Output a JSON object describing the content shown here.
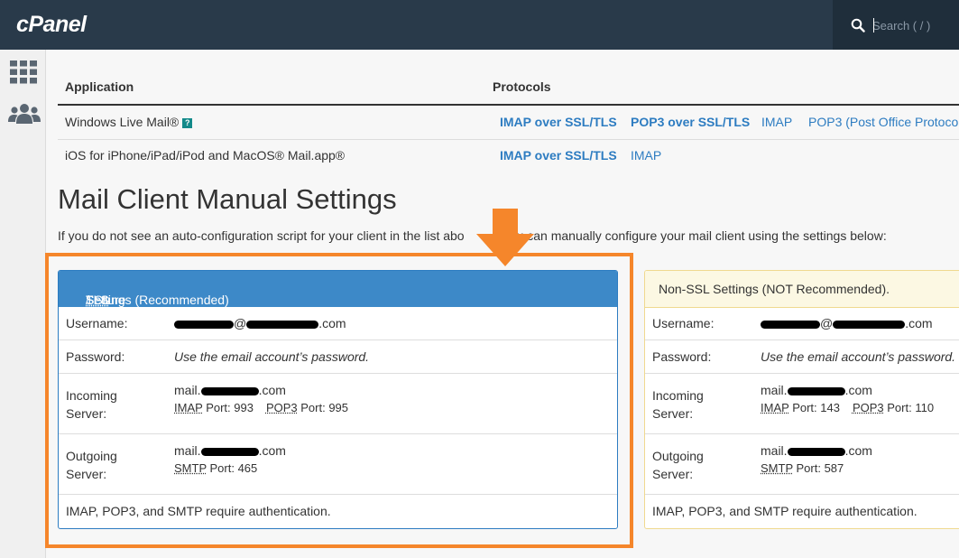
{
  "header": {
    "logo": "cPanel",
    "search_placeholder": "Search ( / )"
  },
  "table": {
    "col_application": "Application",
    "col_protocols": "Protocols",
    "rows": [
      {
        "app": "Windows Live Mail®",
        "protocols": [
          "IMAP over SSL/TLS",
          "POP3 over SSL/TLS",
          "IMAP",
          "POP3 (Post Office Protoco"
        ]
      },
      {
        "app": "iOS for iPhone/iPad/iPod and MacOS® Mail.app®",
        "protocols": [
          "IMAP over SSL/TLS",
          "IMAP"
        ]
      }
    ]
  },
  "manual": {
    "title": "Mail Client Manual Settings",
    "intro_a": "If you do not see an auto-configuration script for your client in the list abo",
    "intro_b": "u can manually configure your mail client using the settings below:"
  },
  "ssl_panel": {
    "heading_pre": "Secure ",
    "heading_ssl": "SSL",
    "heading_sep": "/",
    "heading_tls": "TLS",
    "heading_post": " Settings (Recommended)",
    "username_label": "Username:",
    "username_a": "",
    "username_b": "@",
    "username_c": ".com",
    "password_label": "Password:",
    "password_value": "Use the email account’s password.",
    "incoming_label_1": "Incoming",
    "incoming_label_2": "Server:",
    "incoming_host_a": "mail.",
    "incoming_host_b": ".com",
    "imap": "IMAP",
    "imap_port": "Port: 993",
    "pop3": "POP3",
    "pop3_port": "Port: 995",
    "outgoing_label_1": "Outgoing",
    "outgoing_label_2": "Server:",
    "outgoing_host_a": "mail.",
    "outgoing_host_b": ".com",
    "smtp": "SMTP",
    "smtp_port": "Port: 465",
    "footer": "IMAP, POP3, and SMTP require authentication."
  },
  "non_ssl_panel": {
    "heading": "Non-SSL Settings (NOT Recommended).",
    "username_label": "Username:",
    "username_b": "@",
    "username_c": ".com",
    "password_label": "Password:",
    "password_value": "Use the email account’s password.",
    "incoming_label_1": "Incoming",
    "incoming_label_2": "Server:",
    "incoming_host_a": "mail.",
    "incoming_host_b": ".com",
    "imap": "IMAP",
    "imap_port": "Port: 143",
    "pop3": "POP3",
    "pop3_port": "Port: 110",
    "outgoing_label_1": "Outgoing",
    "outgoing_label_2": "Server:",
    "outgoing_host_a": "mail.",
    "outgoing_host_b": ".com",
    "smtp": "SMTP",
    "smtp_port": "Port: 587",
    "footer": "IMAP, POP3, and SMTP require authentication."
  },
  "icons": {
    "search": "search-icon",
    "apps_grid": "grid-icon",
    "users": "users-icon",
    "help": "help-icon",
    "arrow": "arrow-down-icon"
  },
  "colors": {
    "topbar": "#293a4a",
    "link": "#2d7cc1",
    "ssl_header": "#3d89c8",
    "non_ssl_header": "#fcf8e3",
    "highlight": "#f5862b"
  }
}
